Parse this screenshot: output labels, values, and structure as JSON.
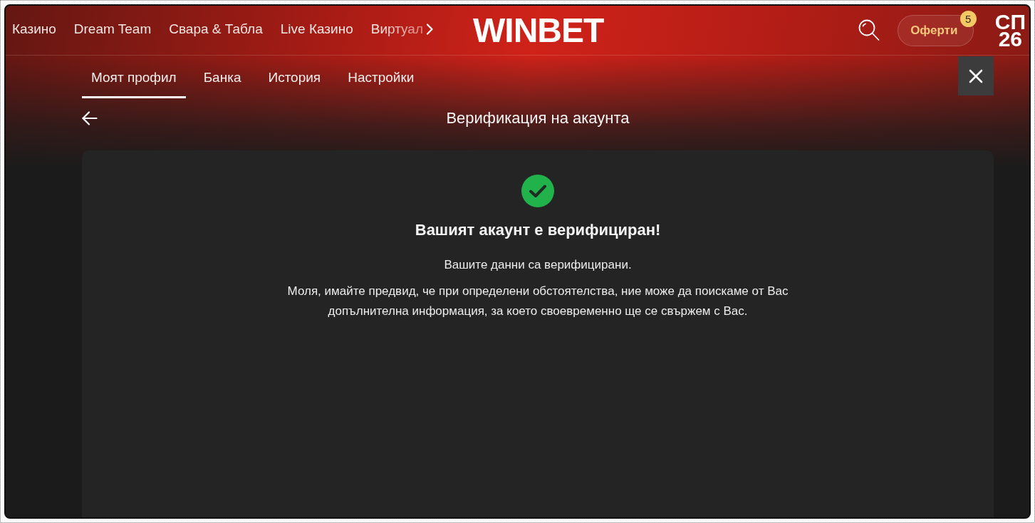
{
  "top_nav": {
    "items": [
      {
        "label": "Казино"
      },
      {
        "label": "Dream Team"
      },
      {
        "label": "Свара & Табла"
      },
      {
        "label": "Live Казино"
      },
      {
        "label": "Виртуал"
      }
    ]
  },
  "logo": "WINBET",
  "offers_button": {
    "label": "Оферти",
    "badge": "5"
  },
  "brand_mark": [
    "СП",
    "26"
  ],
  "profile_tabs": [
    {
      "label": "Моят профил",
      "selected": true
    },
    {
      "label": "Банка",
      "selected": false
    },
    {
      "label": "История",
      "selected": false
    },
    {
      "label": "Настройки",
      "selected": false
    }
  ],
  "page_title": "Верификация на акаунта",
  "verification": {
    "heading": "Вашият акаунт е верифициран!",
    "message": "Вашите данни са верифицирани.",
    "note": "Моля, имайте предвид, че при определени обстоятелства, ние може да поискаме от Вас допълнителна информация, за което своевременно ще се свържем с Вас."
  }
}
